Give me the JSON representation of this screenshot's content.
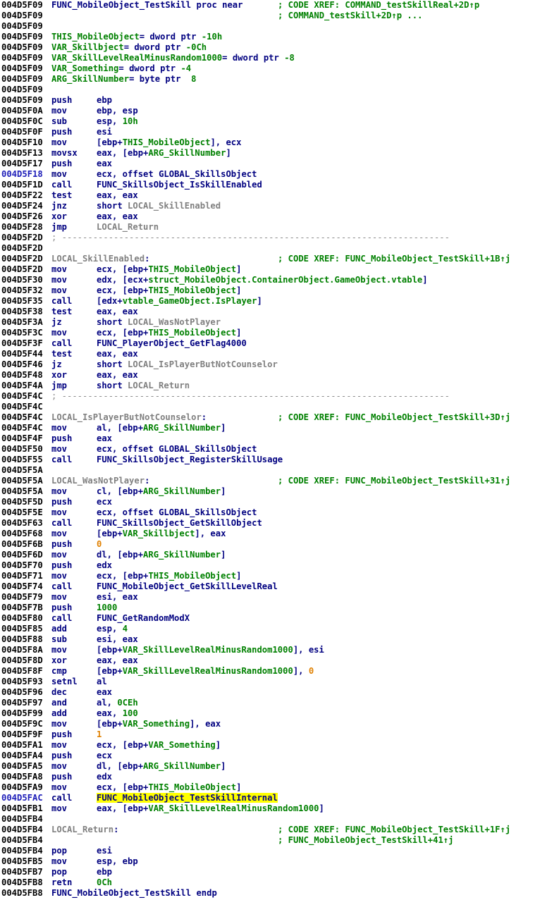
{
  "view": "disassembly-listing",
  "colors": {
    "address": "#000000",
    "mnemonic": "#000080",
    "name": "#000080",
    "green": "#008000",
    "local_label": "#808080",
    "number": "#e08000",
    "highlight": "#ffff00"
  },
  "lines": [
    {
      "a": "004D5F09",
      "lbl": [
        [
          "FUNC_MobileObject_TestSkill proc near",
          "b"
        ]
      ],
      "c": "; CODE XREF: COMMAND_testSkillReal+2D↑p"
    },
    {
      "a": "004D5F09",
      "c": "; COMMAND_testSkill+2D↑p ..."
    },
    {
      "a": "004D5F09"
    },
    {
      "a": "004D5F09",
      "lbl": [
        [
          "THIS_MobileObject",
          "g"
        ],
        [
          "= dword ptr ",
          "n"
        ],
        [
          "-10h",
          "g"
        ]
      ]
    },
    {
      "a": "004D5F09",
      "lbl": [
        [
          "VAR_Skillbject",
          "g"
        ],
        [
          "= dword ptr ",
          "n"
        ],
        [
          "-0Ch",
          "g"
        ]
      ]
    },
    {
      "a": "004D5F09",
      "lbl": [
        [
          "VAR_SkillLevelRealMinusRandom1000",
          "g"
        ],
        [
          "= dword ptr ",
          "n"
        ],
        [
          "-8",
          "g"
        ]
      ]
    },
    {
      "a": "004D5F09",
      "lbl": [
        [
          "VAR_Something",
          "g"
        ],
        [
          "= dword ptr ",
          "n"
        ],
        [
          "-4",
          "g"
        ]
      ]
    },
    {
      "a": "004D5F09",
      "lbl": [
        [
          "ARG_SkillNumber",
          "g"
        ],
        [
          "= byte ptr  ",
          "n"
        ],
        [
          "8",
          "g"
        ]
      ]
    },
    {
      "a": "004D5F09"
    },
    {
      "a": "004D5F09",
      "m": "push",
      "o": [
        [
          "ebp",
          "n"
        ]
      ]
    },
    {
      "a": "004D5F0A",
      "m": "mov",
      "o": [
        [
          "ebp, esp",
          "n"
        ]
      ]
    },
    {
      "a": "004D5F0C",
      "m": "sub",
      "o": [
        [
          "esp, ",
          "n"
        ],
        [
          "10h",
          "g"
        ]
      ]
    },
    {
      "a": "004D5F0F",
      "m": "push",
      "o": [
        [
          "esi",
          "n"
        ]
      ]
    },
    {
      "a": "004D5F10",
      "m": "mov",
      "o": [
        [
          "[ebp+",
          "n"
        ],
        [
          "THIS_MobileObject",
          "g"
        ],
        [
          "], ecx",
          "n"
        ]
      ]
    },
    {
      "a": "004D5F13",
      "m": "movsx",
      "o": [
        [
          "eax, [ebp+",
          "n"
        ],
        [
          "ARG_SkillNumber",
          "g"
        ],
        [
          "]",
          "n"
        ]
      ]
    },
    {
      "a": "004D5F17",
      "m": "push",
      "o": [
        [
          "eax",
          "n"
        ]
      ]
    },
    {
      "a": "004D5F18",
      "hl": true,
      "m": "mov",
      "o": [
        [
          "ecx, offset ",
          "n"
        ],
        [
          "GLOBAL_SkillsObject",
          "b"
        ]
      ]
    },
    {
      "a": "004D5F1D",
      "m": "call",
      "o": [
        [
          "FUNC_SkillsObject_IsSkillEnabled",
          "b"
        ]
      ]
    },
    {
      "a": "004D5F22",
      "m": "test",
      "o": [
        [
          "eax, eax",
          "n"
        ]
      ]
    },
    {
      "a": "004D5F24",
      "m": "jnz",
      "o": [
        [
          "short ",
          "n"
        ],
        [
          "LOCAL_SkillEnabled",
          "k"
        ]
      ]
    },
    {
      "a": "004D5F26",
      "m": "xor",
      "o": [
        [
          "eax, eax",
          "n"
        ]
      ]
    },
    {
      "a": "004D5F28",
      "m": "jmp",
      "o": [
        [
          "LOCAL_Return",
          "k"
        ]
      ]
    },
    {
      "a": "004D5F2D",
      "sep": "; ---------------------------------------------------------------------------"
    },
    {
      "a": "004D5F2D"
    },
    {
      "a": "004D5F2D",
      "lbl": [
        [
          "LOCAL_SkillEnabled",
          "k"
        ],
        [
          ":",
          "n"
        ]
      ],
      "c": "; CODE XREF: FUNC_MobileObject_TestSkill+1B↑j"
    },
    {
      "a": "004D5F2D",
      "m": "mov",
      "o": [
        [
          "ecx, [ebp+",
          "n"
        ],
        [
          "THIS_MobileObject",
          "g"
        ],
        [
          "]",
          "n"
        ]
      ]
    },
    {
      "a": "004D5F30",
      "m": "mov",
      "o": [
        [
          "edx, [ecx+",
          "n"
        ],
        [
          "struct_MobileObject.ContainerObject.GameObject.vtable",
          "g"
        ],
        [
          "]",
          "n"
        ]
      ]
    },
    {
      "a": "004D5F32",
      "m": "mov",
      "o": [
        [
          "ecx, [ebp+",
          "n"
        ],
        [
          "THIS_MobileObject",
          "g"
        ],
        [
          "]",
          "n"
        ]
      ]
    },
    {
      "a": "004D5F35",
      "m": "call",
      "o": [
        [
          "[edx+",
          "n"
        ],
        [
          "vtable_GameObject.IsPlayer",
          "g"
        ],
        [
          "]",
          "n"
        ]
      ]
    },
    {
      "a": "004D5F38",
      "m": "test",
      "o": [
        [
          "eax, eax",
          "n"
        ]
      ]
    },
    {
      "a": "004D5F3A",
      "m": "jz",
      "o": [
        [
          "short ",
          "n"
        ],
        [
          "LOCAL_WasNotPlayer",
          "k"
        ]
      ]
    },
    {
      "a": "004D5F3C",
      "m": "mov",
      "o": [
        [
          "ecx, [ebp+",
          "n"
        ],
        [
          "THIS_MobileObject",
          "g"
        ],
        [
          "]",
          "n"
        ]
      ]
    },
    {
      "a": "004D5F3F",
      "m": "call",
      "o": [
        [
          "FUNC_PlayerObject_GetFlag4000",
          "b"
        ]
      ]
    },
    {
      "a": "004D5F44",
      "m": "test",
      "o": [
        [
          "eax, eax",
          "n"
        ]
      ]
    },
    {
      "a": "004D5F46",
      "m": "jz",
      "o": [
        [
          "short ",
          "n"
        ],
        [
          "LOCAL_IsPlayerButNotCounselor",
          "k"
        ]
      ]
    },
    {
      "a": "004D5F48",
      "m": "xor",
      "o": [
        [
          "eax, eax",
          "n"
        ]
      ]
    },
    {
      "a": "004D5F4A",
      "m": "jmp",
      "o": [
        [
          "short ",
          "n"
        ],
        [
          "LOCAL_Return",
          "k"
        ]
      ]
    },
    {
      "a": "004D5F4C",
      "sep": "; ---------------------------------------------------------------------------"
    },
    {
      "a": "004D5F4C"
    },
    {
      "a": "004D5F4C",
      "lbl": [
        [
          "LOCAL_IsPlayerButNotCounselor",
          "k"
        ],
        [
          ":",
          "n"
        ]
      ],
      "c": "; CODE XREF: FUNC_MobileObject_TestSkill+3D↑j"
    },
    {
      "a": "004D5F4C",
      "m": "mov",
      "o": [
        [
          "al, [ebp+",
          "n"
        ],
        [
          "ARG_SkillNumber",
          "g"
        ],
        [
          "]",
          "n"
        ]
      ]
    },
    {
      "a": "004D5F4F",
      "m": "push",
      "o": [
        [
          "eax",
          "n"
        ]
      ]
    },
    {
      "a": "004D5F50",
      "m": "mov",
      "o": [
        [
          "ecx, offset ",
          "n"
        ],
        [
          "GLOBAL_SkillsObject",
          "b"
        ]
      ]
    },
    {
      "a": "004D5F55",
      "m": "call",
      "o": [
        [
          "FUNC_SkillsObject_RegisterSkillUsage",
          "b"
        ]
      ]
    },
    {
      "a": "004D5F5A"
    },
    {
      "a": "004D5F5A",
      "lbl": [
        [
          "LOCAL_WasNotPlayer",
          "k"
        ],
        [
          ":",
          "n"
        ]
      ],
      "c": "; CODE XREF: FUNC_MobileObject_TestSkill+31↑j"
    },
    {
      "a": "004D5F5A",
      "m": "mov",
      "o": [
        [
          "cl, [ebp+",
          "n"
        ],
        [
          "ARG_SkillNumber",
          "g"
        ],
        [
          "]",
          "n"
        ]
      ]
    },
    {
      "a": "004D5F5D",
      "m": "push",
      "o": [
        [
          "ecx",
          "n"
        ]
      ]
    },
    {
      "a": "004D5F5E",
      "m": "mov",
      "o": [
        [
          "ecx, offset ",
          "n"
        ],
        [
          "GLOBAL_SkillsObject",
          "b"
        ]
      ]
    },
    {
      "a": "004D5F63",
      "m": "call",
      "o": [
        [
          "FUNC_SkillsObject_GetSkillObject",
          "b"
        ]
      ]
    },
    {
      "a": "004D5F68",
      "m": "mov",
      "o": [
        [
          "[ebp+",
          "n"
        ],
        [
          "VAR_Skillbject",
          "g"
        ],
        [
          "], eax",
          "n"
        ]
      ]
    },
    {
      "a": "004D5F6B",
      "m": "push",
      "o": [
        [
          "0",
          "o"
        ]
      ]
    },
    {
      "a": "004D5F6D",
      "m": "mov",
      "o": [
        [
          "dl, [ebp+",
          "n"
        ],
        [
          "ARG_SkillNumber",
          "g"
        ],
        [
          "]",
          "n"
        ]
      ]
    },
    {
      "a": "004D5F70",
      "m": "push",
      "o": [
        [
          "edx",
          "n"
        ]
      ]
    },
    {
      "a": "004D5F71",
      "m": "mov",
      "o": [
        [
          "ecx, [ebp+",
          "n"
        ],
        [
          "THIS_MobileObject",
          "g"
        ],
        [
          "]",
          "n"
        ]
      ]
    },
    {
      "a": "004D5F74",
      "m": "call",
      "o": [
        [
          "FUNC_MobileObject_GetSkillLevelReal",
          "b"
        ]
      ]
    },
    {
      "a": "004D5F79",
      "m": "mov",
      "o": [
        [
          "esi, eax",
          "n"
        ]
      ]
    },
    {
      "a": "004D5F7B",
      "m": "push",
      "o": [
        [
          "1000",
          "g"
        ]
      ]
    },
    {
      "a": "004D5F80",
      "m": "call",
      "o": [
        [
          "FUNC_GetRandomModX",
          "b"
        ]
      ]
    },
    {
      "a": "004D5F85",
      "m": "add",
      "o": [
        [
          "esp, ",
          "n"
        ],
        [
          "4",
          "g"
        ]
      ]
    },
    {
      "a": "004D5F88",
      "m": "sub",
      "o": [
        [
          "esi, eax",
          "n"
        ]
      ]
    },
    {
      "a": "004D5F8A",
      "m": "mov",
      "o": [
        [
          "[ebp+",
          "n"
        ],
        [
          "VAR_SkillLevelRealMinusRandom1000",
          "g"
        ],
        [
          "], esi",
          "n"
        ]
      ]
    },
    {
      "a": "004D5F8D",
      "m": "xor",
      "o": [
        [
          "eax, eax",
          "n"
        ]
      ]
    },
    {
      "a": "004D5F8F",
      "m": "cmp",
      "o": [
        [
          "[ebp+",
          "n"
        ],
        [
          "VAR_SkillLevelRealMinusRandom1000",
          "g"
        ],
        [
          "], ",
          "n"
        ],
        [
          "0",
          "o"
        ]
      ]
    },
    {
      "a": "004D5F93",
      "m": "setnl",
      "o": [
        [
          "al",
          "n"
        ]
      ]
    },
    {
      "a": "004D5F96",
      "m": "dec",
      "o": [
        [
          "eax",
          "n"
        ]
      ]
    },
    {
      "a": "004D5F97",
      "m": "and",
      "o": [
        [
          "al, ",
          "n"
        ],
        [
          "0CEh",
          "g"
        ]
      ]
    },
    {
      "a": "004D5F99",
      "m": "add",
      "o": [
        [
          "eax, ",
          "n"
        ],
        [
          "100",
          "g"
        ]
      ]
    },
    {
      "a": "004D5F9C",
      "m": "mov",
      "o": [
        [
          "[ebp+",
          "n"
        ],
        [
          "VAR_Something",
          "g"
        ],
        [
          "], eax",
          "n"
        ]
      ]
    },
    {
      "a": "004D5F9F",
      "m": "push",
      "o": [
        [
          "1",
          "o"
        ]
      ]
    },
    {
      "a": "004D5FA1",
      "m": "mov",
      "o": [
        [
          "ecx, [ebp+",
          "n"
        ],
        [
          "VAR_Something",
          "g"
        ],
        [
          "]",
          "n"
        ]
      ]
    },
    {
      "a": "004D5FA4",
      "m": "push",
      "o": [
        [
          "ecx",
          "n"
        ]
      ]
    },
    {
      "a": "004D5FA5",
      "m": "mov",
      "o": [
        [
          "dl, [ebp+",
          "n"
        ],
        [
          "ARG_SkillNumber",
          "g"
        ],
        [
          "]",
          "n"
        ]
      ]
    },
    {
      "a": "004D5FA8",
      "m": "push",
      "o": [
        [
          "edx",
          "n"
        ]
      ]
    },
    {
      "a": "004D5FA9",
      "m": "mov",
      "o": [
        [
          "ecx, [ebp+",
          "n"
        ],
        [
          "THIS_MobileObject",
          "g"
        ],
        [
          "]",
          "n"
        ]
      ]
    },
    {
      "a": "004D5FAC",
      "hl": true,
      "m": "call",
      "o": [
        [
          "FUNC_MobileObject_TestSkillInternal",
          "h"
        ]
      ]
    },
    {
      "a": "004D5FB1",
      "m": "mov",
      "o": [
        [
          "eax, [ebp+",
          "n"
        ],
        [
          "VAR_SkillLevelRealMinusRandom1000",
          "g"
        ],
        [
          "]",
          "n"
        ]
      ]
    },
    {
      "a": "004D5FB4"
    },
    {
      "a": "004D5FB4",
      "lbl": [
        [
          "LOCAL_Return",
          "k"
        ],
        [
          ":",
          "n"
        ]
      ],
      "c": "; CODE XREF: FUNC_MobileObject_TestSkill+1F↑j"
    },
    {
      "a": "004D5FB4",
      "c": "; FUNC_MobileObject_TestSkill+41↑j"
    },
    {
      "a": "004D5FB4",
      "m": "pop",
      "o": [
        [
          "esi",
          "n"
        ]
      ]
    },
    {
      "a": "004D5FB5",
      "m": "mov",
      "o": [
        [
          "esp, ebp",
          "n"
        ]
      ]
    },
    {
      "a": "004D5FB7",
      "m": "pop",
      "o": [
        [
          "ebp",
          "n"
        ]
      ]
    },
    {
      "a": "004D5FB8",
      "m": "retn",
      "o": [
        [
          "0Ch",
          "g"
        ]
      ]
    },
    {
      "a": "004D5FB8",
      "lbl": [
        [
          "FUNC_MobileObject_TestSkill endp",
          "b"
        ]
      ]
    }
  ]
}
